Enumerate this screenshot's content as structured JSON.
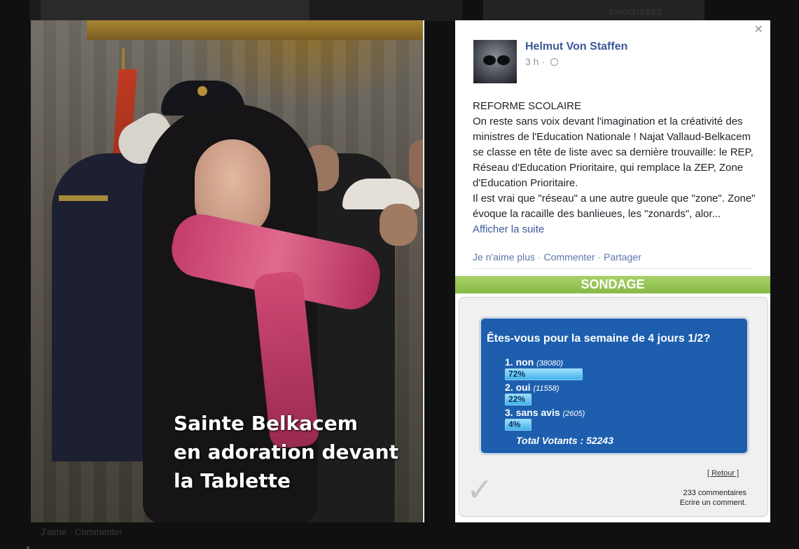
{
  "background": {
    "card_text": "CHOISISSEZ",
    "actions": "J'aime · Commenter"
  },
  "photo": {
    "caption_lines": [
      "Sainte Belkacem",
      "en adoration devant",
      "la Tablette"
    ]
  },
  "post": {
    "author": "Helmut Von Staffen",
    "time": "3 h ·",
    "paragraphs": [
      "REFORME SCOLAIRE",
      "On reste sans voix devant l'imagination et la créativité des ministres de l'Education Nationale ! Najat Vallaud-Belkacem se classe en tête de liste avec sa dernière trouvaille: le REP, Réseau d'Education Prioritaire, qui remplace la ZEP, Zone d'Education Prioritaire.",
      "Il est vrai que \"réseau\" a une autre gueule que \"zone\". Zone\" évoque la racaille des banlieues, les \"zonards\", alor..."
    ],
    "see_more": "Afficher la suite",
    "actions": {
      "unlike": "Je n'aime plus",
      "comment": "Commenter",
      "share": "Partager",
      "separator": "·"
    }
  },
  "poll": {
    "banner": "SONDAGE",
    "question": "Êtes-vous pour la semaine de 4 jours 1/2?",
    "options": [
      {
        "label": "1. non",
        "votes": "(38080)",
        "percent": "72%",
        "share": 0.72
      },
      {
        "label": "2. oui",
        "votes": "(11558)",
        "percent": "22%",
        "share": 0.22
      },
      {
        "label": "3. sans avis",
        "votes": "(2605)",
        "percent": "4%",
        "share": 0.04
      }
    ],
    "total": "Total Votants : 52243",
    "retour": "[ Retour ]",
    "comments_count": "233 commentaires",
    "write_comment": "Ecrire un comment."
  },
  "icons": {
    "close": "close-icon",
    "globe": "globe-icon",
    "check": "checkmark-icon"
  }
}
